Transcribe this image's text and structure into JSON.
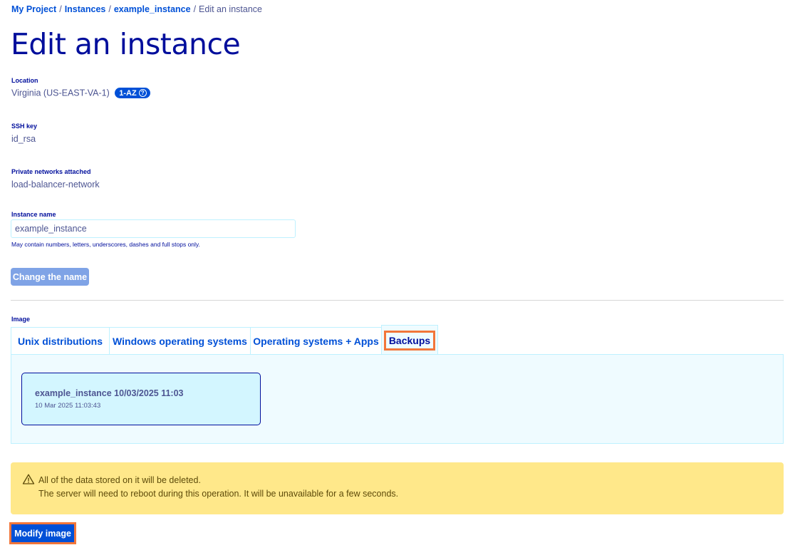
{
  "breadcrumb": {
    "items": [
      "My Project",
      "Instances",
      "example_instance"
    ],
    "separator": "/",
    "current": "Edit an instance"
  },
  "page_title": "Edit an instance",
  "location": {
    "label": "Location",
    "value": "Virginia (US-EAST-VA-1)",
    "badge": "1-AZ",
    "help_icon": "question-circle-icon"
  },
  "ssh_key": {
    "label": "SSH key",
    "value": "id_rsa"
  },
  "private_networks": {
    "label": "Private networks attached",
    "value": "load-balancer-network"
  },
  "instance_name": {
    "label": "Instance name",
    "value": "example_instance",
    "hint": "May contain numbers, letters, underscores, dashes and full stops only.",
    "button": "Change the name"
  },
  "image": {
    "label": "Image",
    "tabs": [
      "Unix distributions",
      "Windows operating systems",
      "Operating systems + Apps",
      "Backups"
    ],
    "active_tab": "Backups",
    "backup": {
      "title": "example_instance 10/03/2025 11:03",
      "date": "10 Mar 2025 11:03:43"
    }
  },
  "warning": {
    "icon": "warning-triangle-icon",
    "line1": "All of the data stored on it will be deleted.",
    "line2": "The server will need to reboot during this operation. It will be unavailable for a few seconds."
  },
  "modify_button": "Modify image",
  "colors": {
    "primary": "#0050d7",
    "heading": "#000e9c",
    "text": "#4d5592",
    "highlight": "#f2763a",
    "warning_bg": "#ffe88a",
    "panel_bg": "#effbff",
    "card_bg": "#d3f6ff"
  }
}
